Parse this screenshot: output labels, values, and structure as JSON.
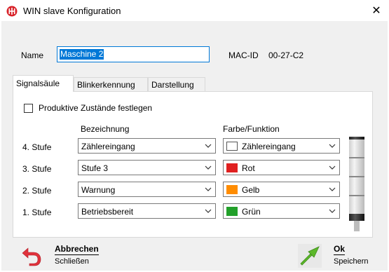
{
  "window": {
    "title": "WIN slave Konfiguration",
    "close_glyph": "✕"
  },
  "header": {
    "name_label": "Name",
    "name_value": "Maschine 2",
    "mac_label": "MAC-ID",
    "mac_value": "00-27-C2"
  },
  "tabs": [
    {
      "label": "Signalsäule",
      "active": true
    },
    {
      "label": "Blinkerkennung",
      "active": false
    },
    {
      "label": "Darstellung",
      "active": false
    }
  ],
  "signal": {
    "checkbox_label": "Produktive Zustände festlegen",
    "checkbox_checked": false,
    "col_bezeichnung": "Bezeichnung",
    "col_farbe": "Farbe/Funktion",
    "rows": [
      {
        "label": "4. Stufe",
        "bezeichnung": "Zählereingang",
        "farbe": "Zählereingang",
        "color": "#ffffff"
      },
      {
        "label": "3. Stufe",
        "bezeichnung": "Stufe 3",
        "farbe": "Rot",
        "color": "#e02020"
      },
      {
        "label": "2. Stufe",
        "bezeichnung": "Warnung",
        "farbe": "Gelb",
        "color": "#ff8c00"
      },
      {
        "label": "1. Stufe",
        "bezeichnung": "Betriebsbereit",
        "farbe": "Grün",
        "color": "#22a02a"
      }
    ]
  },
  "footer": {
    "cancel_title": "Abbrechen",
    "cancel_sub": "Schließen",
    "ok_title": "Ok",
    "ok_sub": "Speichern"
  },
  "colors": {
    "accent": "#0078d7",
    "cancel_icon": "#e0323c",
    "ok_icon": "#5cb82a"
  }
}
